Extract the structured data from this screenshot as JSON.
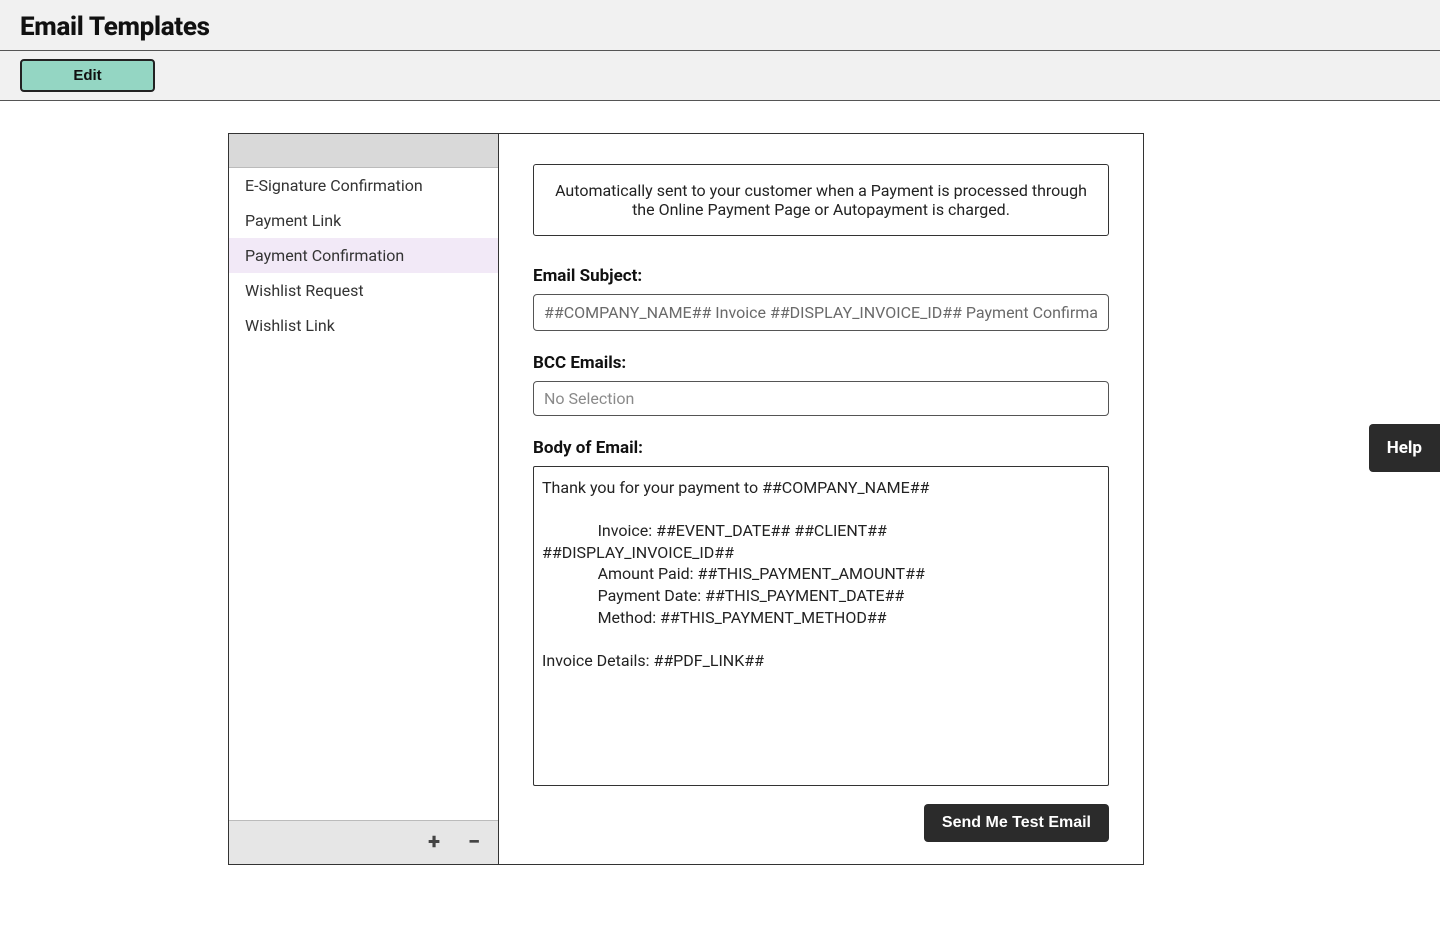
{
  "header": {
    "title": "Email Templates"
  },
  "toolbar": {
    "edit_label": "Edit"
  },
  "sidebar": {
    "items": [
      {
        "label": "E-Signature Confirmation",
        "selected": false
      },
      {
        "label": "Payment Link",
        "selected": false
      },
      {
        "label": "Payment Confirmation",
        "selected": true
      },
      {
        "label": "Wishlist Request",
        "selected": false
      },
      {
        "label": "Wishlist Link",
        "selected": false
      }
    ],
    "add_icon": "+",
    "remove_icon": "−"
  },
  "detail": {
    "description": "Automatically sent to your customer when a Payment is processed through the Online Payment Page or Autopayment is charged.",
    "subject_label": "Email Subject:",
    "subject_value": "##COMPANY_NAME## Invoice ##DISPLAY_INVOICE_ID## Payment Confirmati",
    "bcc_label": "BCC  Emails:",
    "bcc_placeholder": "No Selection",
    "body_label": "Body of Email:",
    "body_value": "Thank you for your payment to ##COMPANY_NAME##\n\n              Invoice: ##EVENT_DATE## ##CLIENT##\n##DISPLAY_INVOICE_ID##\n              Amount Paid: ##THIS_PAYMENT_AMOUNT##\n              Payment Date: ##THIS_PAYMENT_DATE##\n              Method: ##THIS_PAYMENT_METHOD##\n\nInvoice Details: ##PDF_LINK##",
    "test_button_label": "Send Me Test Email"
  },
  "help": {
    "label": "Help"
  }
}
